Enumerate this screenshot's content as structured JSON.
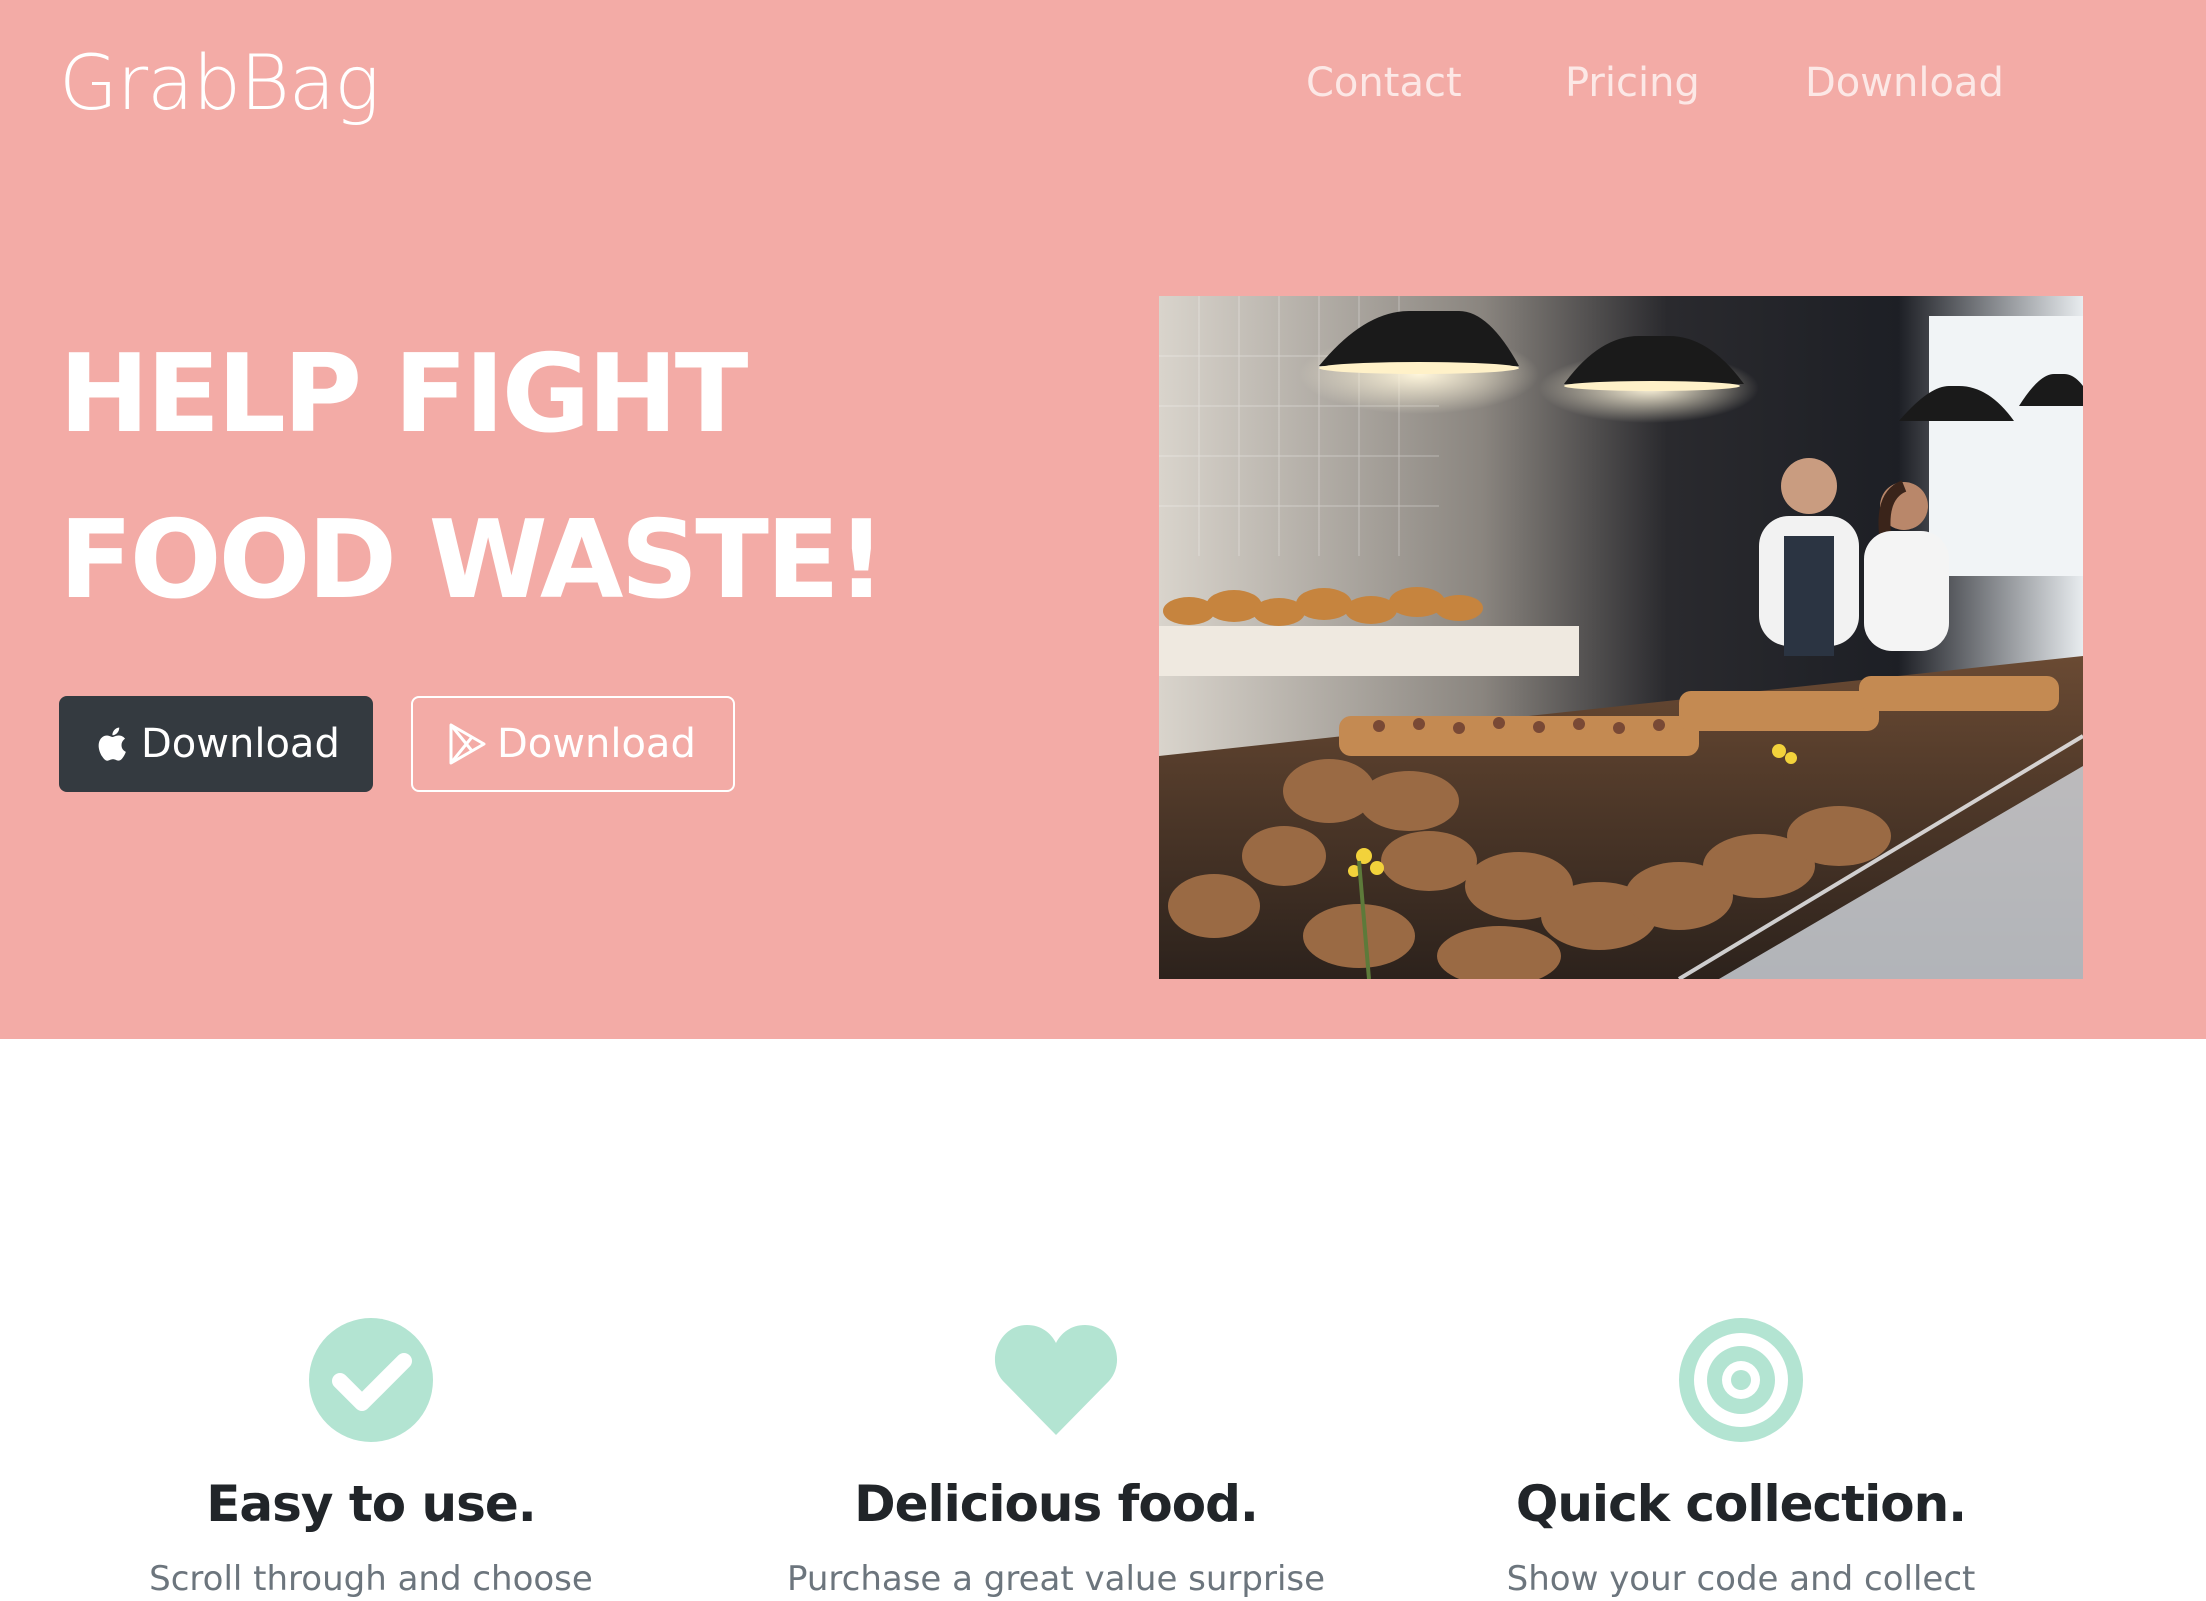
{
  "nav": {
    "brand": "GrabBag",
    "links": [
      {
        "label": "Contact"
      },
      {
        "label": "Pricing"
      },
      {
        "label": "Download"
      }
    ]
  },
  "hero": {
    "headline_line1": "HELP FIGHT",
    "headline_line2": "FOOD WASTE!",
    "buttons": {
      "ios": {
        "label": "Download",
        "icon": "apple-icon"
      },
      "android": {
        "label": "Download",
        "icon": "google-play-icon"
      }
    },
    "image": {
      "icon": "bakery-photo"
    }
  },
  "features": [
    {
      "icon": "checkmark-circle-icon",
      "title": "Easy to use.",
      "text": "Scroll through and choose"
    },
    {
      "icon": "heart-icon",
      "title": "Delicious food.",
      "text": "Purchase a great value surprise"
    },
    {
      "icon": "target-icon",
      "title": "Quick collection.",
      "text": "Show your code and collect"
    }
  ],
  "colors": {
    "hero_bg": "#f3aba6",
    "accent_mint": "#b3e4d2",
    "dark_button": "#343a40",
    "heading": "#212529"
  }
}
